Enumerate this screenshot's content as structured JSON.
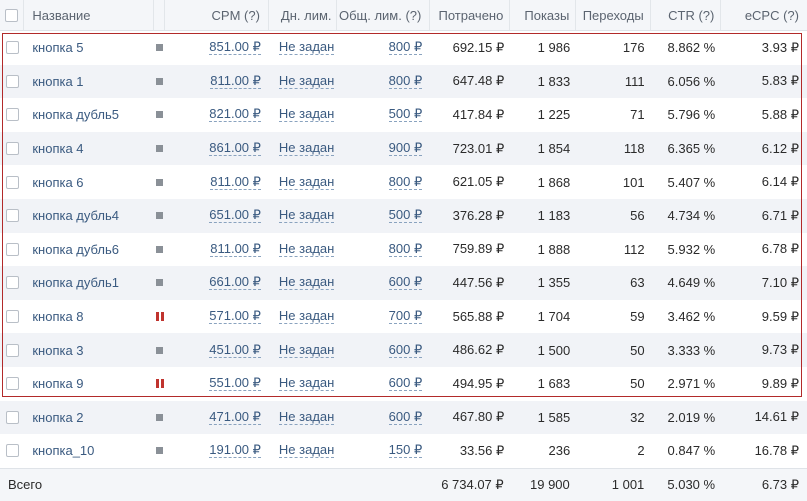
{
  "columns": {
    "name": "Название",
    "cpm": "CPM (?)",
    "daily_limit": "Дн. лим.",
    "total_limit": "Общ. лим. (?)",
    "spent": "Потрачено",
    "shows": "Показы",
    "clicks": "Переходы",
    "ctr": "CTR (?)",
    "ecpc": "eCPC (?)"
  },
  "rows": [
    {
      "name": "кнопка 5",
      "status": "active",
      "cpm": "851.00 ₽",
      "daily_limit": "Не задан",
      "total_limit": "800 ₽",
      "spent": "692.15 ₽",
      "shows": "1 986",
      "clicks": "176",
      "ctr": "8.862 %",
      "ecpc": "3.93 ₽"
    },
    {
      "name": "кнопка 1",
      "status": "active",
      "cpm": "811.00 ₽",
      "daily_limit": "Не задан",
      "total_limit": "800 ₽",
      "spent": "647.48 ₽",
      "shows": "1 833",
      "clicks": "111",
      "ctr": "6.056 %",
      "ecpc": "5.83 ₽"
    },
    {
      "name": "кнопка дубль5",
      "status": "active",
      "cpm": "821.00 ₽",
      "daily_limit": "Не задан",
      "total_limit": "500 ₽",
      "spent": "417.84 ₽",
      "shows": "1 225",
      "clicks": "71",
      "ctr": "5.796 %",
      "ecpc": "5.88 ₽"
    },
    {
      "name": "кнопка 4",
      "status": "active",
      "cpm": "861.00 ₽",
      "daily_limit": "Не задан",
      "total_limit": "900 ₽",
      "spent": "723.01 ₽",
      "shows": "1 854",
      "clicks": "118",
      "ctr": "6.365 %",
      "ecpc": "6.12 ₽"
    },
    {
      "name": "кнопка 6",
      "status": "active",
      "cpm": "811.00 ₽",
      "daily_limit": "Не задан",
      "total_limit": "800 ₽",
      "spent": "621.05 ₽",
      "shows": "1 868",
      "clicks": "101",
      "ctr": "5.407 %",
      "ecpc": "6.14 ₽"
    },
    {
      "name": "кнопка дубль4",
      "status": "active",
      "cpm": "651.00 ₽",
      "daily_limit": "Не задан",
      "total_limit": "500 ₽",
      "spent": "376.28 ₽",
      "shows": "1 183",
      "clicks": "56",
      "ctr": "4.734 %",
      "ecpc": "6.71 ₽"
    },
    {
      "name": "кнопка дубль6",
      "status": "active",
      "cpm": "811.00 ₽",
      "daily_limit": "Не задан",
      "total_limit": "800 ₽",
      "spent": "759.89 ₽",
      "shows": "1 888",
      "clicks": "112",
      "ctr": "5.932 %",
      "ecpc": "6.78 ₽"
    },
    {
      "name": "кнопка дубль1",
      "status": "active",
      "cpm": "661.00 ₽",
      "daily_limit": "Не задан",
      "total_limit": "600 ₽",
      "spent": "447.56 ₽",
      "shows": "1 355",
      "clicks": "63",
      "ctr": "4.649 %",
      "ecpc": "7.10 ₽"
    },
    {
      "name": "кнопка 8",
      "status": "paused",
      "cpm": "571.00 ₽",
      "daily_limit": "Не задан",
      "total_limit": "700 ₽",
      "spent": "565.88 ₽",
      "shows": "1 704",
      "clicks": "59",
      "ctr": "3.462 %",
      "ecpc": "9.59 ₽"
    },
    {
      "name": "кнопка 3",
      "status": "active",
      "cpm": "451.00 ₽",
      "daily_limit": "Не задан",
      "total_limit": "600 ₽",
      "spent": "486.62 ₽",
      "shows": "1 500",
      "clicks": "50",
      "ctr": "3.333 %",
      "ecpc": "9.73 ₽"
    },
    {
      "name": "кнопка 9",
      "status": "paused",
      "cpm": "551.00 ₽",
      "daily_limit": "Не задан",
      "total_limit": "600 ₽",
      "spent": "494.95 ₽",
      "shows": "1 683",
      "clicks": "50",
      "ctr": "2.971 %",
      "ecpc": "9.89 ₽"
    },
    {
      "name": "кнопка 2",
      "status": "active",
      "cpm": "471.00 ₽",
      "daily_limit": "Не задан",
      "total_limit": "600 ₽",
      "spent": "467.80 ₽",
      "shows": "1 585",
      "clicks": "32",
      "ctr": "2.019 %",
      "ecpc": "14.61 ₽"
    },
    {
      "name": "кнопка_10",
      "status": "active",
      "cpm": "191.00 ₽",
      "daily_limit": "Не задан",
      "total_limit": "150 ₽",
      "spent": "33.56 ₽",
      "shows": "236",
      "clicks": "2",
      "ctr": "0.847 %",
      "ecpc": "16.78 ₽"
    }
  ],
  "total": {
    "label": "Всего",
    "spent": "6 734.07 ₽",
    "shows": "19 900",
    "clicks": "1 001",
    "ctr": "5.030 %",
    "ecpc": "6.73 ₽"
  },
  "colors": {
    "link": "#3a5a80",
    "highlight_border": "#b22a2a",
    "pause_icon": "#c0332e",
    "active_icon": "#8a9097",
    "header_bg": "#f4f6f9",
    "alt_row_bg": "#f1f3f7"
  },
  "icons": {
    "active": "status-square-icon",
    "paused": "pause-icon"
  }
}
